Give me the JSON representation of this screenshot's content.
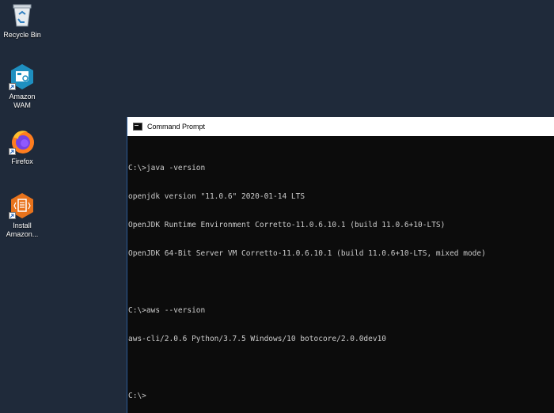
{
  "desktop": {
    "icons": [
      {
        "label": "Recycle Bin",
        "icon": "recycle-bin-icon"
      },
      {
        "label": "Amazon\nWAM",
        "icon": "amazon-wam-icon"
      },
      {
        "label": "Firefox",
        "icon": "firefox-icon"
      },
      {
        "label": "Install\nAmazon...",
        "icon": "install-amazon-icon"
      }
    ]
  },
  "cmd": {
    "title": "Command Prompt",
    "lines": [
      "C:\\>java -version",
      "openjdk version \"11.0.6\" 2020-01-14 LTS",
      "OpenJDK Runtime Environment Corretto-11.0.6.10.1 (build 11.0.6+10-LTS)",
      "OpenJDK 64-Bit Server VM Corretto-11.0.6.10.1 (build 11.0.6+10-LTS, mixed mode)",
      "",
      "C:\\>aws --version",
      "aws-cli/2.0.6 Python/3.7.5 Windows/10 botocore/2.0.0dev10",
      "",
      "C:\\>"
    ]
  },
  "colors": {
    "desktop_bg": "#1f2a3a",
    "console_bg": "#0c0c0c",
    "console_text": "#cccccc",
    "amazon_wam": "#1e8fc0",
    "install_amazon": "#e8731c"
  }
}
